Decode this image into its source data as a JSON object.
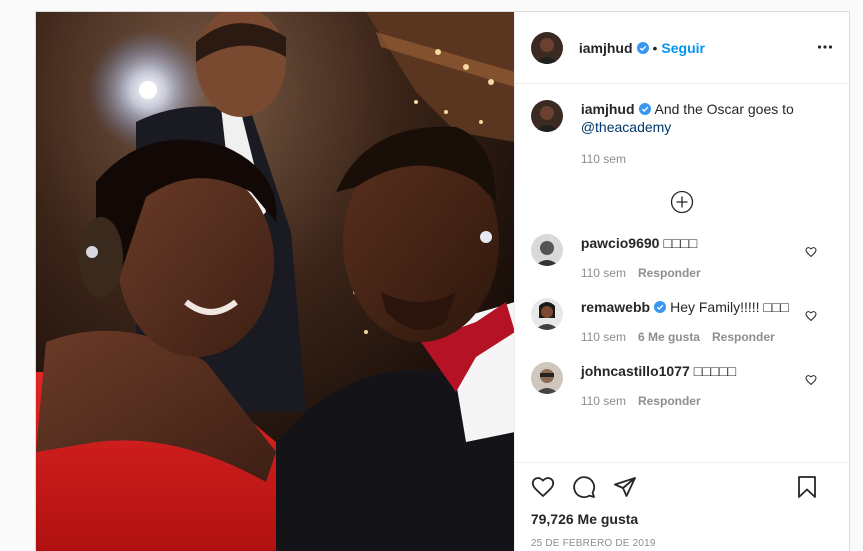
{
  "post": {
    "author": "iamjhud",
    "follow_label": "Seguir",
    "caption": {
      "username": "iamjhud",
      "text": "And the Oscar goes to",
      "mention": "@theacademy",
      "time": "110 sem"
    },
    "comments": [
      {
        "username": "pawcio9690",
        "text": "□□□□",
        "time": "110 sem",
        "likes": "",
        "reply": "Responder",
        "verified": false
      },
      {
        "username": "remawebb",
        "text": "Hey Family!!!!! □□□",
        "time": "110 sem",
        "likes": "6 Me gusta",
        "reply": "Responder",
        "verified": true
      },
      {
        "username": "johncastillo1077",
        "text": "□□□□□",
        "time": "110 sem",
        "likes": "",
        "reply": "Responder",
        "verified": false
      }
    ],
    "likes_count": "79,726 Me gusta",
    "date": "25 DE FEBRERO DE 2019"
  },
  "colors": {
    "accent": "#0095f6",
    "verified": "#3897f0",
    "muted": "#8e8e8e",
    "text": "#262626"
  },
  "icons": [
    "verified-icon",
    "more-icon",
    "add-circle-icon",
    "heart-icon",
    "comment-icon",
    "share-icon",
    "save-icon"
  ]
}
